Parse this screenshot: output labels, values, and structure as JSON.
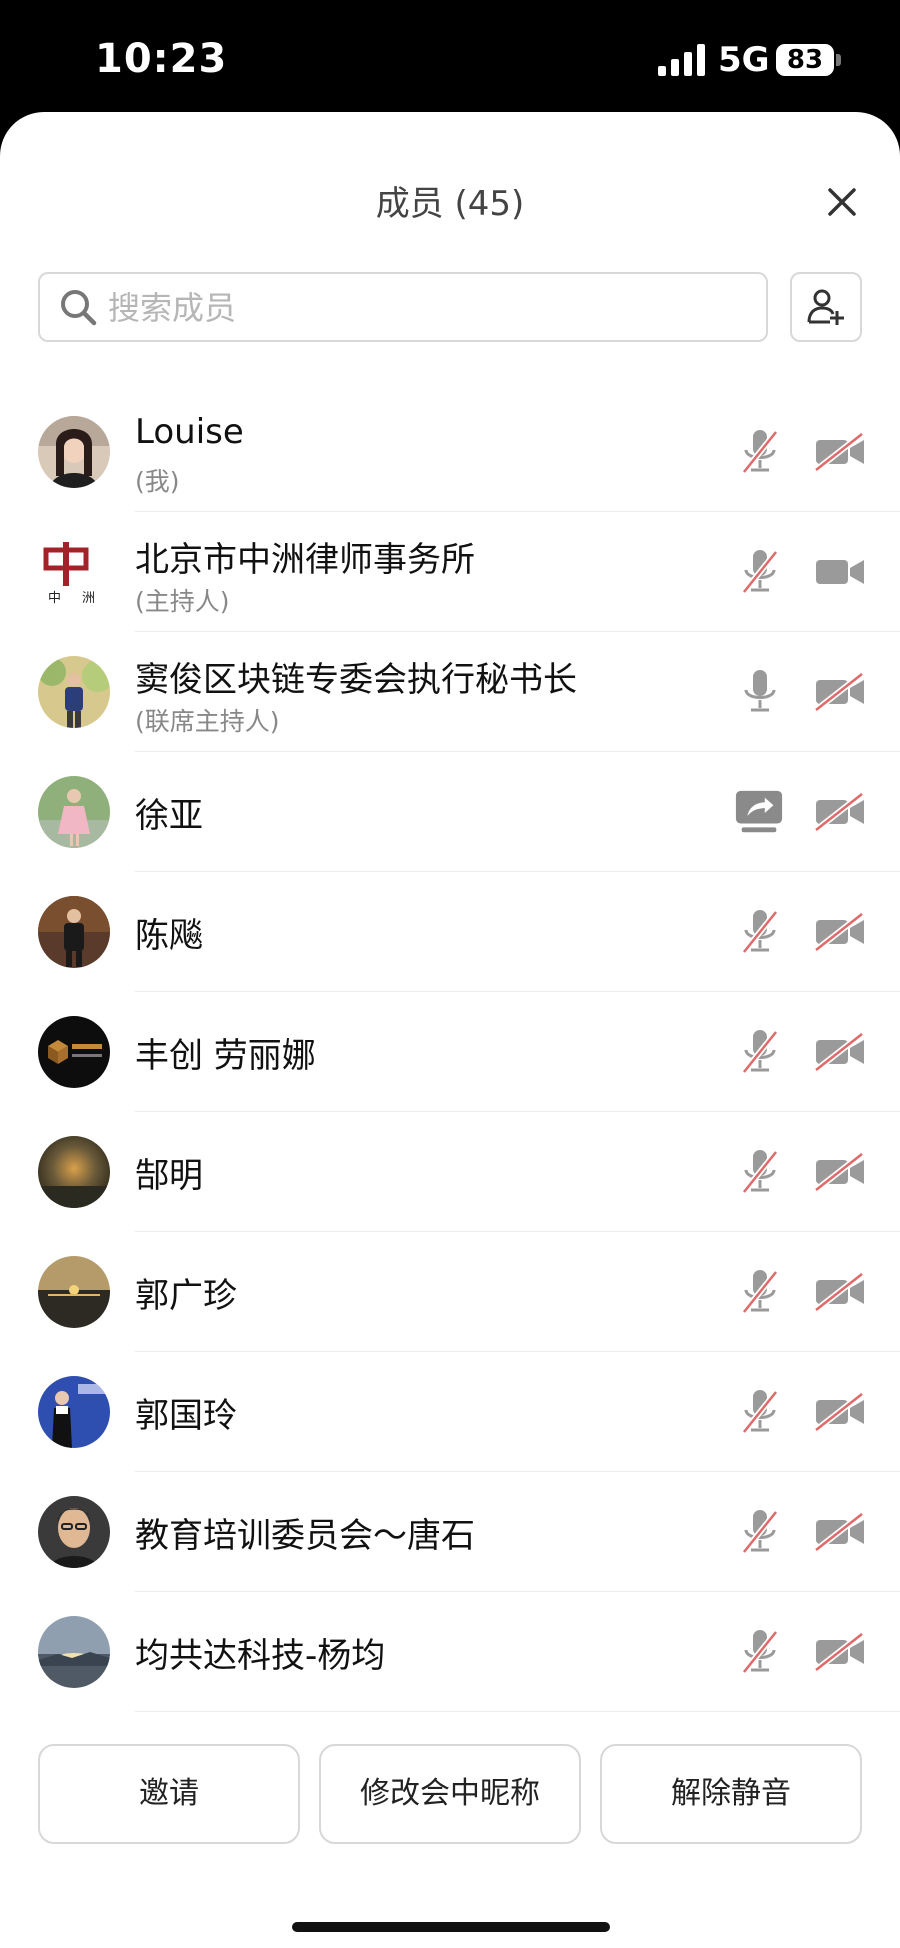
{
  "status": {
    "time": "10:23",
    "network": "5G",
    "battery": "83"
  },
  "header": {
    "title": "成员 (45)"
  },
  "search": {
    "placeholder": "搜索成员"
  },
  "members": [
    {
      "name": "Louise",
      "role": "(我)",
      "mic": "muted",
      "cam": "off",
      "avatar": "photo-woman"
    },
    {
      "name": "北京市中洲律师事务所",
      "role": "(主持人)",
      "mic": "muted",
      "cam": "on",
      "avatar": "logo-zhongzhou"
    },
    {
      "name": "窦俊区块链专委会执行秘书长",
      "role": "(联席主持人)",
      "mic": "on",
      "cam": "off",
      "avatar": "photo-man-outdoor"
    },
    {
      "name": "徐亚",
      "role": "",
      "mic": "screen-share",
      "cam": "off",
      "avatar": "photo-girl"
    },
    {
      "name": "陈飚",
      "role": "",
      "mic": "muted",
      "cam": "off",
      "avatar": "photo-man-suit"
    },
    {
      "name": "丰创 劳丽娜",
      "role": "",
      "mic": "muted",
      "cam": "off",
      "avatar": "logo-fengchuang"
    },
    {
      "name": "郜明",
      "role": "",
      "mic": "muted",
      "cam": "off",
      "avatar": "photo-sunset-dark"
    },
    {
      "name": "郭广珍",
      "role": "",
      "mic": "muted",
      "cam": "off",
      "avatar": "photo-sea-sunset"
    },
    {
      "name": "郭国玲",
      "role": "",
      "mic": "muted",
      "cam": "off",
      "avatar": "photo-woman-stage"
    },
    {
      "name": "教育培训委员会～唐石",
      "role": "",
      "mic": "muted",
      "cam": "off",
      "avatar": "photo-man-portrait"
    },
    {
      "name": "均共达科技-杨均",
      "role": "",
      "mic": "muted",
      "cam": "off",
      "avatar": "photo-lake-sky"
    }
  ],
  "footer": {
    "invite": "邀请",
    "rename": "修改会中昵称",
    "unmute": "解除静音"
  },
  "colors": {
    "icon_gray": "#9a9a9a",
    "mute_red": "#e06a6a"
  }
}
